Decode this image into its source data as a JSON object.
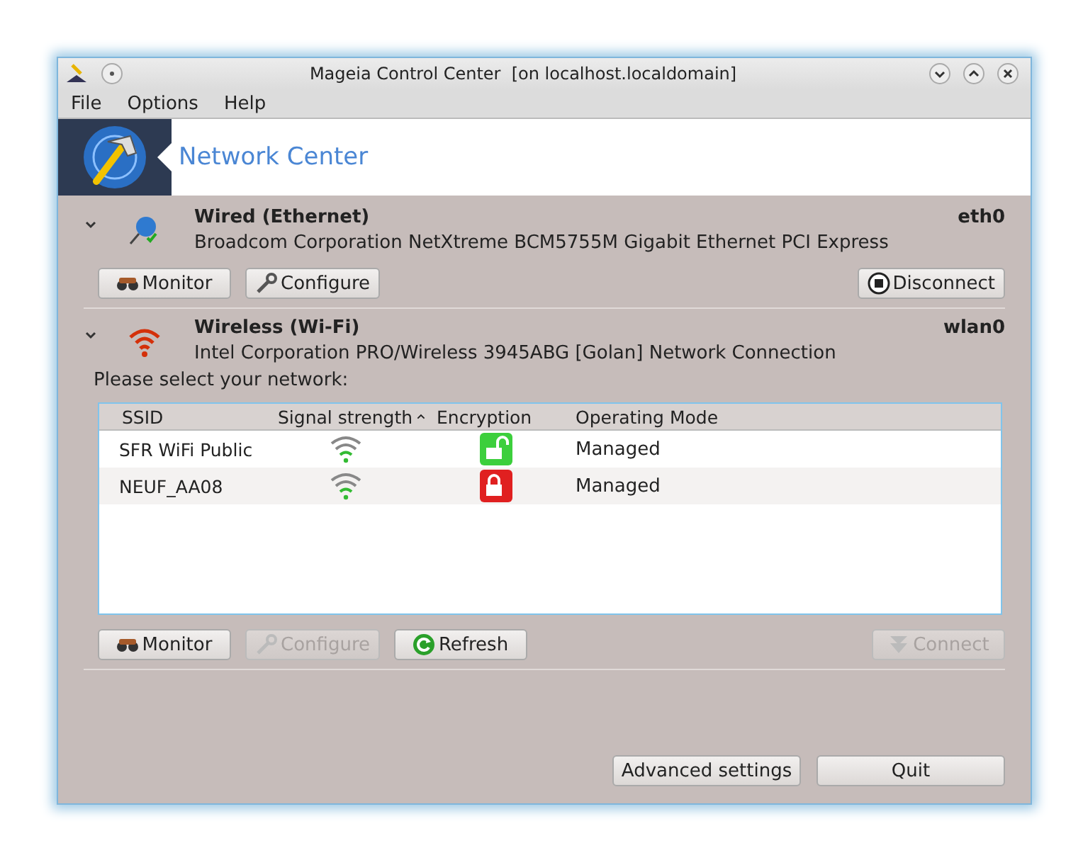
{
  "window": {
    "title": "Mageia Control Center  [on localhost.localdomain]"
  },
  "menu": [
    "File",
    "Options",
    "Help"
  ],
  "header": {
    "title": "Network Center"
  },
  "interfaces": [
    {
      "kind": "wired",
      "expanded": true,
      "name": "Wired (Ethernet)",
      "device": "eth0",
      "description": "Broadcom Corporation NetXtreme BCM5755M Gigabit Ethernet PCI Express",
      "buttons": [
        {
          "kind": "monitor",
          "label": "Monitor",
          "disabled": false
        },
        {
          "kind": "configure",
          "label": "Configure",
          "disabled": false
        },
        {
          "kind": "disconnect",
          "label": "Disconnect",
          "disabled": false
        }
      ]
    },
    {
      "kind": "wireless",
      "expanded": true,
      "name": "Wireless (Wi-Fi)",
      "device": "wlan0",
      "description": "Intel Corporation PRO/Wireless 3945ABG [Golan] Network Connection",
      "prompt": "Please select your network:",
      "table": {
        "columns": [
          {
            "label": "SSID",
            "sorted": false
          },
          {
            "label": "Signal strength",
            "sorted": true
          },
          {
            "label": "Encryption",
            "sorted": false
          },
          {
            "label": "Operating Mode",
            "sorted": false
          }
        ],
        "rows": [
          {
            "ssid": "SFR WiFi Public",
            "encrypted": false,
            "mode": "Managed"
          },
          {
            "ssid": "NEUF_AA08",
            "encrypted": true,
            "mode": "Managed"
          }
        ]
      },
      "buttons": [
        {
          "kind": "monitor",
          "label": "Monitor",
          "disabled": false
        },
        {
          "kind": "configure",
          "label": "Configure",
          "disabled": true
        },
        {
          "kind": "refresh",
          "label": "Refresh",
          "disabled": false
        },
        {
          "kind": "connect",
          "label": "Connect",
          "disabled": true
        }
      ]
    }
  ],
  "footer": [
    "Advanced settings",
    "Quit"
  ]
}
